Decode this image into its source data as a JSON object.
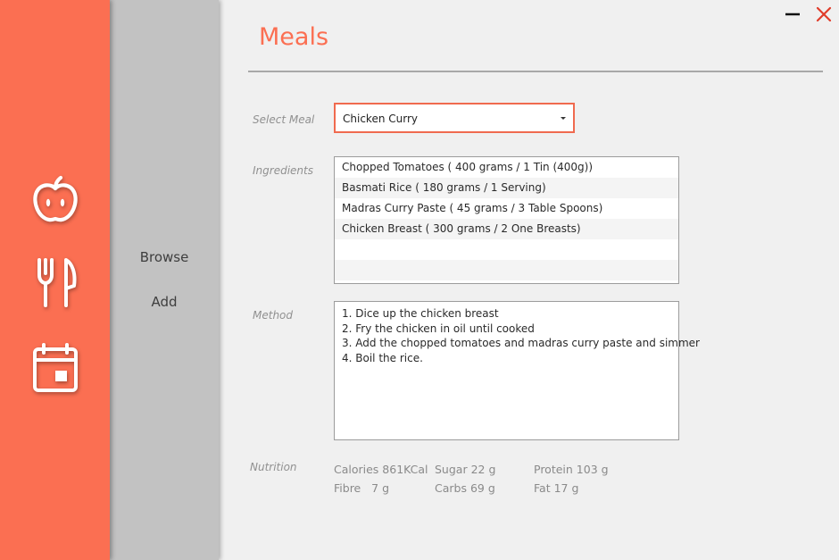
{
  "window": {
    "minimize_icon": "minimize-icon",
    "close_icon": "close-icon",
    "close_color": "#e03c2a"
  },
  "rail": {
    "background": "#fb6f52",
    "icons": [
      "apple-icon",
      "fork-knife-icon",
      "calendar-icon"
    ]
  },
  "subnav": {
    "items": [
      "Browse",
      "Add"
    ]
  },
  "page": {
    "title": "Meals",
    "select_meal_label": "Select Meal",
    "selected_meal": "Chicken Curry",
    "ingredients_label": "Ingredients",
    "ingredients": [
      "Chopped Tomatoes ( 400 grams / 1 Tin (400g))",
      "Basmati Rice ( 180 grams / 1 Serving)",
      "Madras Curry Paste ( 45 grams / 3 Table Spoons)",
      "Chicken Breast ( 300 grams / 2 One Breasts)"
    ],
    "method_label": "Method",
    "method": [
      "1. Dice up the chicken breast",
      "2. Fry the chicken in oil until cooked",
      "3. Add the chopped tomatoes and madras curry paste and simmer",
      "4. Boil the rice."
    ],
    "nutrition_label": "Nutrition",
    "nutrition": {
      "calories": "Calories 861KCal",
      "sugar": "Sugar 22 g",
      "protein": "Protein 103 g",
      "fibre": "Fibre   7 g",
      "carbs": "Carbs 69 g",
      "fat": "Fat 17 g"
    }
  }
}
